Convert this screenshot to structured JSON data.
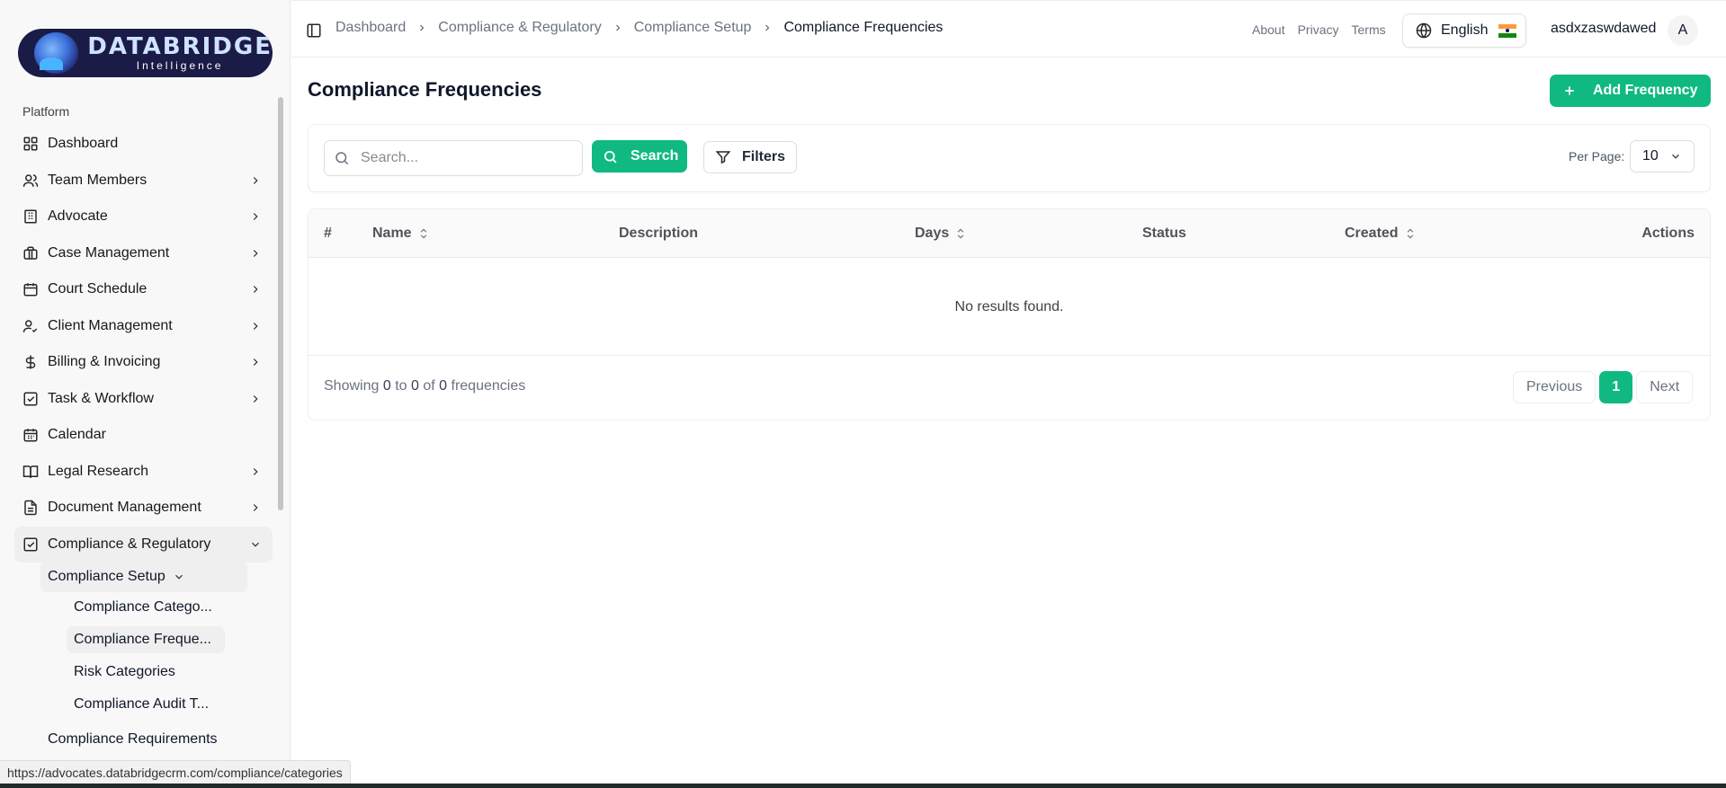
{
  "brand": {
    "name": "DATABRIDGE",
    "tagline": "Intelligence"
  },
  "sidebar": {
    "section": "Platform",
    "items": [
      {
        "label": "Dashboard",
        "icon": "grid-icon",
        "has_children": false
      },
      {
        "label": "Team Members",
        "icon": "users-icon",
        "has_children": true
      },
      {
        "label": "Advocate",
        "icon": "building-icon",
        "has_children": true
      },
      {
        "label": "Case Management",
        "icon": "briefcase-icon",
        "has_children": true
      },
      {
        "label": "Court Schedule",
        "icon": "calendar-icon",
        "has_children": true
      },
      {
        "label": "Client Management",
        "icon": "user-check-icon",
        "has_children": true
      },
      {
        "label": "Billing & Invoicing",
        "icon": "dollar-icon",
        "has_children": true
      },
      {
        "label": "Task & Workflow",
        "icon": "checkbox-icon",
        "has_children": true
      },
      {
        "label": "Calendar",
        "icon": "calendar-icon",
        "has_children": false
      },
      {
        "label": "Legal Research",
        "icon": "book-icon",
        "has_children": true
      },
      {
        "label": "Document Management",
        "icon": "document-icon",
        "has_children": true
      },
      {
        "label": "Compliance & Regulatory",
        "icon": "checkbox-icon",
        "has_children": true,
        "expanded": true
      }
    ],
    "compliance_setup": "Compliance Setup",
    "compliance_setup_children": [
      "Compliance Catego...",
      "Compliance Freque...",
      "Risk Categories",
      "Compliance Audit T..."
    ],
    "compliance_requirements": "Compliance Requirements"
  },
  "status_url": "https://advocates.databridgecrm.com/compliance/categories",
  "header": {
    "breadcrumb": [
      "Dashboard",
      "Compliance & Regulatory",
      "Compliance Setup",
      "Compliance Frequencies"
    ],
    "links": [
      "About",
      "Privacy",
      "Terms"
    ],
    "language": "English",
    "username": "asdxzaswdawed",
    "avatar_initial": "A"
  },
  "page": {
    "title": "Compliance Frequencies",
    "add_button": "Add Frequency",
    "search_placeholder": "Search...",
    "search_button": "Search",
    "filters_button": "Filters",
    "per_page_label": "Per Page:",
    "per_page_value": "10"
  },
  "table": {
    "columns": [
      "#",
      "Name",
      "Description",
      "Days",
      "Status",
      "Created",
      "Actions"
    ],
    "empty_message": "No results found.",
    "showing_prefix": "Showing",
    "showing_from": "0",
    "showing_to_word": "to",
    "showing_to": "0",
    "showing_of_word": "of",
    "showing_total": "0",
    "showing_suffix": "frequencies"
  },
  "pagination": {
    "previous": "Previous",
    "current": "1",
    "next": "Next"
  },
  "colors": {
    "accent": "#10b981",
    "brand_bg": "#1b1b48"
  }
}
